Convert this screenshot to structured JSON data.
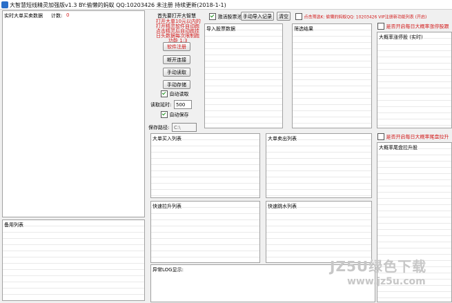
{
  "window": {
    "title": "大智慧短线精灵加强版v1.3    BY:偷懒的蚂蚁 QQ:10203426   未注册          持续更新(2018-1-1)"
  },
  "left": {
    "realtime_title": "实时大单买卖数据",
    "count_label": "计数:",
    "count_value": "0",
    "notes_title": "备用列表"
  },
  "notice": {
    "line1": "首先要打开大智慧",
    "lines_red": [
      "打开大单10元以内的",
      "打开精灵软件自动跑",
      "点击精灵后自动跑挂",
      "日头数据每次限制跑"
    ],
    "line_func": "功能      1:3"
  },
  "buttons": {
    "register": "软件注册",
    "connect": "断开连接",
    "manual_read": "手动读取",
    "manual_save": "手动存储"
  },
  "options": {
    "auto_read": "自动读取",
    "read_delay_label": "读取延时:",
    "read_delay_value": "500",
    "auto_save": "自动保存",
    "save_path_label": "保存路径:",
    "save_path_value": "C:\\"
  },
  "top_bar": {
    "activate_label": "激活股票池",
    "manual_import": "手动导入记录",
    "clear": "清空",
    "vip_text": "点击筛选K: 偷懒的蚂蚁QQ: 10203426  VIP注册新功能列表 (开启)"
  },
  "lists": {
    "import_title": "导入股票数据",
    "filter_title": "筛选结果",
    "big_buy": "大单买入列表",
    "big_sell": "大单卖出列表",
    "fast_up": "快速拉升列表",
    "fast_down": "快速跳水列表",
    "log_title": "异常LOG显示:"
  },
  "right": {
    "opt1": "是否开启每日大概率涨停股跟",
    "list1_title": "大概率涨停股 (实时)",
    "opt2": "是否开启每日大概率尾盘拉升",
    "list2_title": "大概率尾盘拉升股"
  },
  "watermark": {
    "line1": "JZ5U绿色下载",
    "line2": "www.jz5u.com"
  }
}
